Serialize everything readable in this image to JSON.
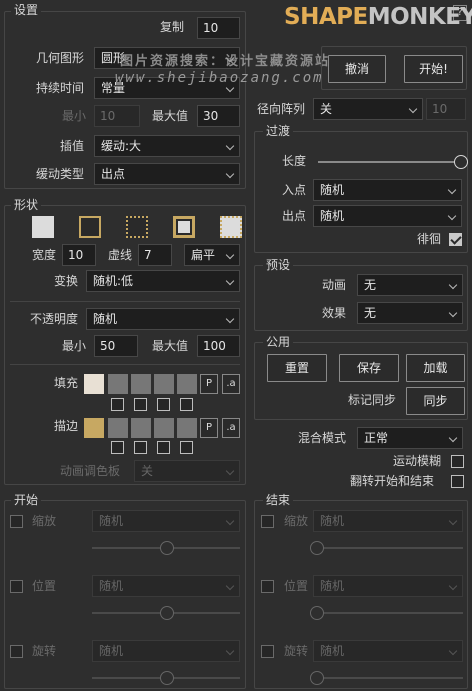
{
  "header": {
    "help": "?",
    "logo_left": "SHAPE",
    "logo_right": "MONKEY",
    "watermark": "图片资源搜索：设计宝藏资源站",
    "watermark_url": "www.shejibaozang.com"
  },
  "settings": {
    "title": "设置",
    "copy_label": "复制",
    "copy_value": "10",
    "shape_label": "几何图形",
    "shape_value": "圆形",
    "duration_label": "持续时间",
    "duration_value": "常量",
    "min_label": "最小",
    "min_value": "10",
    "max_label": "最大值",
    "max_value": "30",
    "interp_label": "插值",
    "interp_value": "缓动:大",
    "ease_label": "缓动类型",
    "ease_value": "出点"
  },
  "actions": {
    "cancel": "撤消",
    "start": "开始!"
  },
  "radial": {
    "label": "径向阵列",
    "value": "关",
    "num": "10"
  },
  "transition": {
    "title": "过渡",
    "length_label": "长度",
    "length_value": 1.0,
    "in_label": "入点",
    "in_value": "随机",
    "out_label": "出点",
    "out_value": "随机",
    "loop_label": "徘徊",
    "loop_checked": true
  },
  "shape": {
    "title": "形状",
    "width_label": "宽度",
    "width_value": "10",
    "dash_label": "虚线",
    "dash_value": "7",
    "cap_value": "扁平",
    "transform_label": "变换",
    "transform_value": "随机:低",
    "opacity_label": "不透明度",
    "opacity_value": "随机",
    "min_label": "最小",
    "min_value": "50",
    "max_label": "最大值",
    "max_value": "100",
    "fill_label": "填充",
    "stroke_label": "描边",
    "p": "P",
    "a": ".a",
    "palette_label": "动画调色板",
    "palette_value": "关",
    "fill_color": "#e8e0d4",
    "stroke_color": "#c7a862"
  },
  "presets": {
    "title": "预设",
    "anim_label": "动画",
    "anim_value": "无",
    "effect_label": "效果",
    "effect_value": "无"
  },
  "common": {
    "title": "公用",
    "reset": "重置",
    "save": "保存",
    "load": "加载",
    "marker_label": "标记同步",
    "sync": "同步"
  },
  "blend": {
    "label": "混合模式",
    "value": "正常",
    "motion_blur": "运动模糊",
    "flip": "翻转开始和结束"
  },
  "start_section": {
    "title": "开始",
    "rows": [
      {
        "label": "缩放",
        "value": "随机"
      },
      {
        "label": "位置",
        "value": "随机"
      },
      {
        "label": "旋转",
        "value": "随机"
      }
    ]
  },
  "end_section": {
    "title": "结束",
    "rows": [
      {
        "label": "缩放",
        "value": "随机"
      },
      {
        "label": "位置",
        "value": "随机"
      },
      {
        "label": "旋转",
        "value": "随机"
      }
    ]
  }
}
